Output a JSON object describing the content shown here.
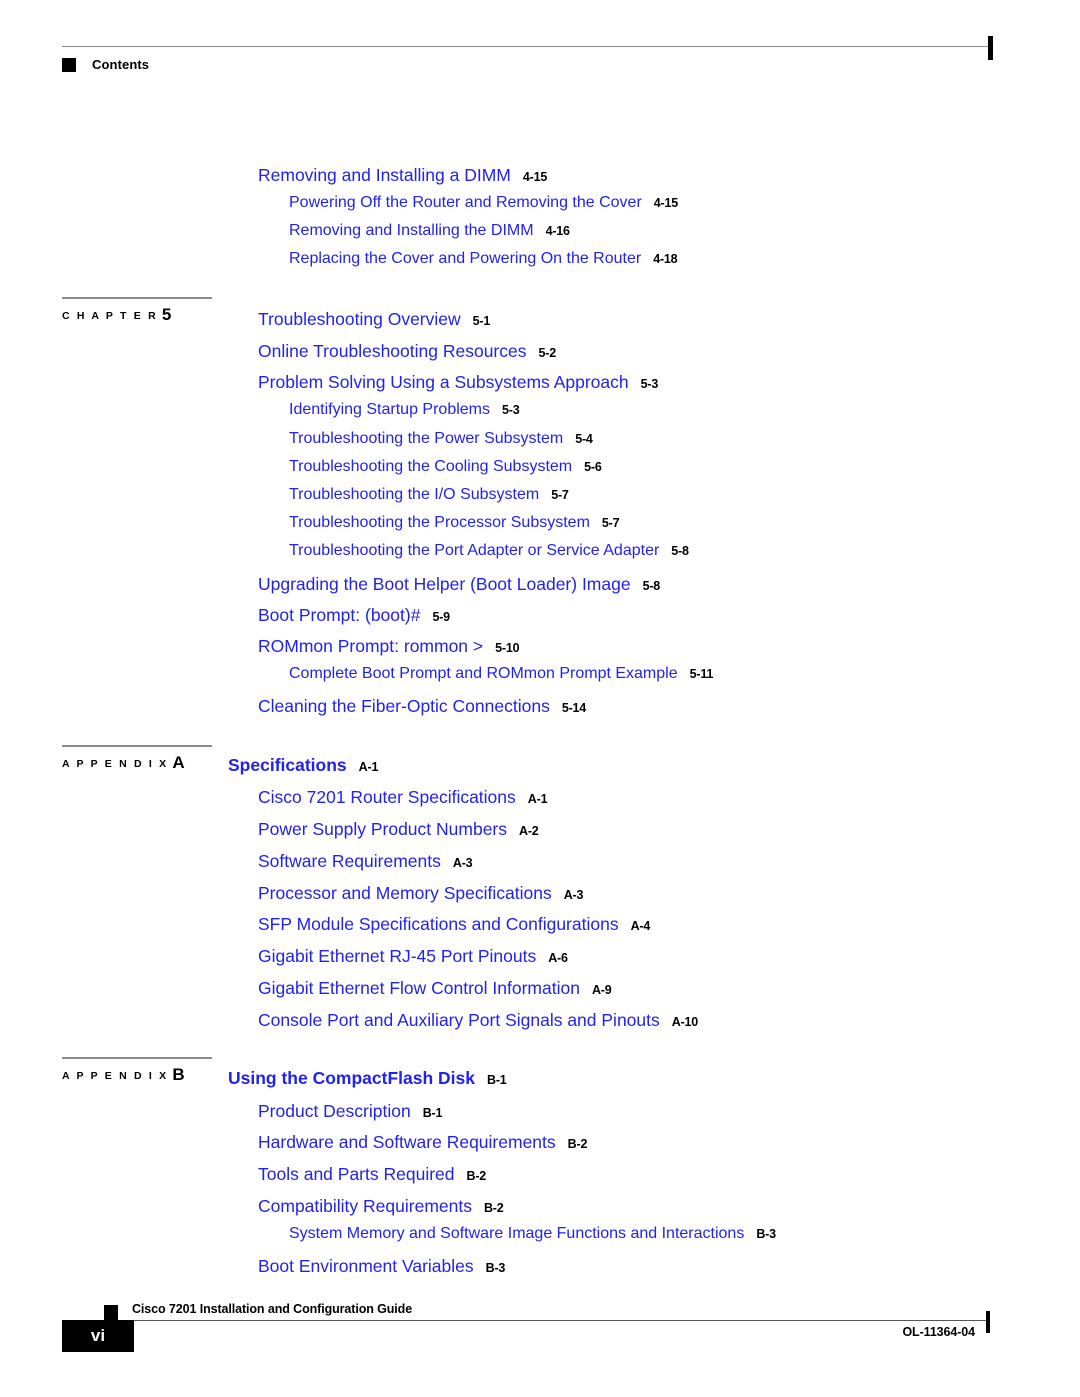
{
  "header": {
    "title": "Contents",
    "marker_icon": "black-square-icon"
  },
  "footer": {
    "guide_title": "Cisco 7201 Installation and Configuration Guide",
    "page_number": "vi",
    "doc_id": "OL-11364-04",
    "marker_icon": "black-square-icon"
  },
  "colors": {
    "link_blue": "#2222ee",
    "rule_gray": "#8a8a8a",
    "text_black": "#000000"
  },
  "groups": [
    {
      "gutter": null,
      "entries": [
        {
          "level": 1,
          "title": "Removing and Installing a DIMM",
          "page": "4-15"
        },
        {
          "level": 2,
          "title": "Powering Off the Router and Removing the Cover",
          "page": "4-15"
        },
        {
          "level": 2,
          "title": "Removing and Installing the DIMM",
          "page": "4-16"
        },
        {
          "level": 2,
          "title": "Replacing the Cover and Powering On the Router",
          "page": "4-18"
        }
      ]
    },
    {
      "gutter": {
        "kind": "C H A P T E R",
        "id": "5"
      },
      "entries": [
        {
          "level": 1,
          "title": "Troubleshooting Overview",
          "page": "5-1"
        },
        {
          "level": 1,
          "title": "Online Troubleshooting Resources",
          "page": "5-2"
        },
        {
          "level": 1,
          "title": "Problem Solving Using a Subsystems Approach",
          "page": "5-3"
        },
        {
          "level": 2,
          "title": "Identifying Startup Problems",
          "page": "5-3"
        },
        {
          "level": 2,
          "title": "Troubleshooting the Power Subsystem",
          "page": "5-4"
        },
        {
          "level": 2,
          "title": "Troubleshooting the Cooling Subsystem",
          "page": "5-6"
        },
        {
          "level": 2,
          "title": "Troubleshooting the I/O Subsystem",
          "page": "5-7"
        },
        {
          "level": 2,
          "title": "Troubleshooting the Processor Subsystem",
          "page": "5-7"
        },
        {
          "level": 2,
          "title": "Troubleshooting the Port Adapter or Service Adapter",
          "page": "5-8"
        },
        {
          "level": 1,
          "title": "Upgrading the Boot Helper (Boot Loader) Image",
          "page": "5-8"
        },
        {
          "level": 1,
          "title": "Boot Prompt: (boot)#",
          "page": "5-9"
        },
        {
          "level": 1,
          "title": "ROMmon Prompt: rommon >",
          "page": "5-10"
        },
        {
          "level": 2,
          "title": "Complete Boot Prompt and ROMmon Prompt Example",
          "page": "5-11"
        },
        {
          "level": 1,
          "title": "Cleaning the Fiber-Optic Connections",
          "page": "5-14"
        }
      ]
    },
    {
      "gutter": {
        "kind": "A P P E N D I X",
        "id": "A"
      },
      "entries": [
        {
          "level": 0,
          "title": "Specifications",
          "page": "A-1"
        },
        {
          "level": 1,
          "title": "Cisco 7201 Router Specifications",
          "page": "A-1"
        },
        {
          "level": 1,
          "title": "Power Supply Product Numbers",
          "page": "A-2"
        },
        {
          "level": 1,
          "title": "Software Requirements",
          "page": "A-3"
        },
        {
          "level": 1,
          "title": "Processor and Memory Specifications",
          "page": "A-3"
        },
        {
          "level": 1,
          "title": "SFP Module Specifications and Configurations",
          "page": "A-4"
        },
        {
          "level": 1,
          "title": "Gigabit Ethernet RJ-45 Port Pinouts",
          "page": "A-6"
        },
        {
          "level": 1,
          "title": "Gigabit Ethernet Flow Control Information",
          "page": "A-9"
        },
        {
          "level": 1,
          "title": "Console Port and Auxiliary Port Signals and Pinouts",
          "page": "A-10"
        }
      ]
    },
    {
      "gutter": {
        "kind": "A P P E N D I X",
        "id": "B"
      },
      "entries": [
        {
          "level": 0,
          "title": "Using the CompactFlash Disk",
          "page": "B-1"
        },
        {
          "level": 1,
          "title": "Product Description",
          "page": "B-1"
        },
        {
          "level": 1,
          "title": "Hardware and Software Requirements",
          "page": "B-2"
        },
        {
          "level": 1,
          "title": "Tools and Parts Required",
          "page": "B-2"
        },
        {
          "level": 1,
          "title": "Compatibility Requirements",
          "page": "B-2"
        },
        {
          "level": 2,
          "title": "System Memory and Software Image Functions and Interactions",
          "page": "B-3"
        },
        {
          "level": 1,
          "title": "Boot Environment Variables",
          "page": "B-3"
        }
      ]
    }
  ],
  "layout": {
    "group_tops": [
      155,
      297,
      745,
      1057
    ],
    "entry_rows": {
      "g0": [
        167,
        195,
        223,
        251
      ],
      "g1": [
        311,
        343,
        374,
        402,
        431,
        459,
        487,
        515,
        543,
        576,
        607,
        638,
        666,
        698
      ],
      "g2": [
        757,
        789,
        821,
        853,
        885,
        916,
        948,
        980,
        1012
      ],
      "g3": [
        1070,
        1103,
        1134,
        1166,
        1198,
        1226,
        1258
      ]
    }
  }
}
